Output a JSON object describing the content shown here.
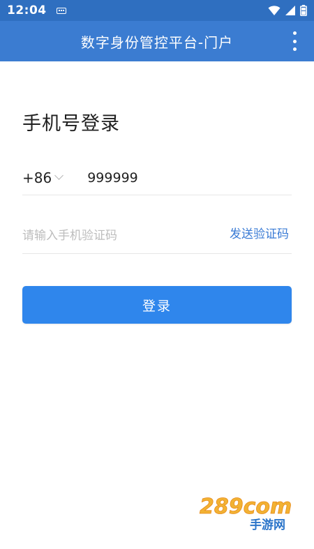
{
  "status_bar": {
    "time": "12:04"
  },
  "app_bar": {
    "title": "数字身份管控平台-门户"
  },
  "login": {
    "title": "手机号登录",
    "country_code": "+86",
    "phone_value": "999999",
    "code_placeholder": "请输入手机验证码",
    "send_code_label": "发送验证码",
    "login_button_label": "登录"
  },
  "watermark": {
    "text": "289com",
    "subtitle": "手游网"
  },
  "colors": {
    "status_bar": "#2f6fc0",
    "app_bar": "#3b7cd1",
    "primary_button": "#2f86ec",
    "link": "#3a7bd5"
  }
}
